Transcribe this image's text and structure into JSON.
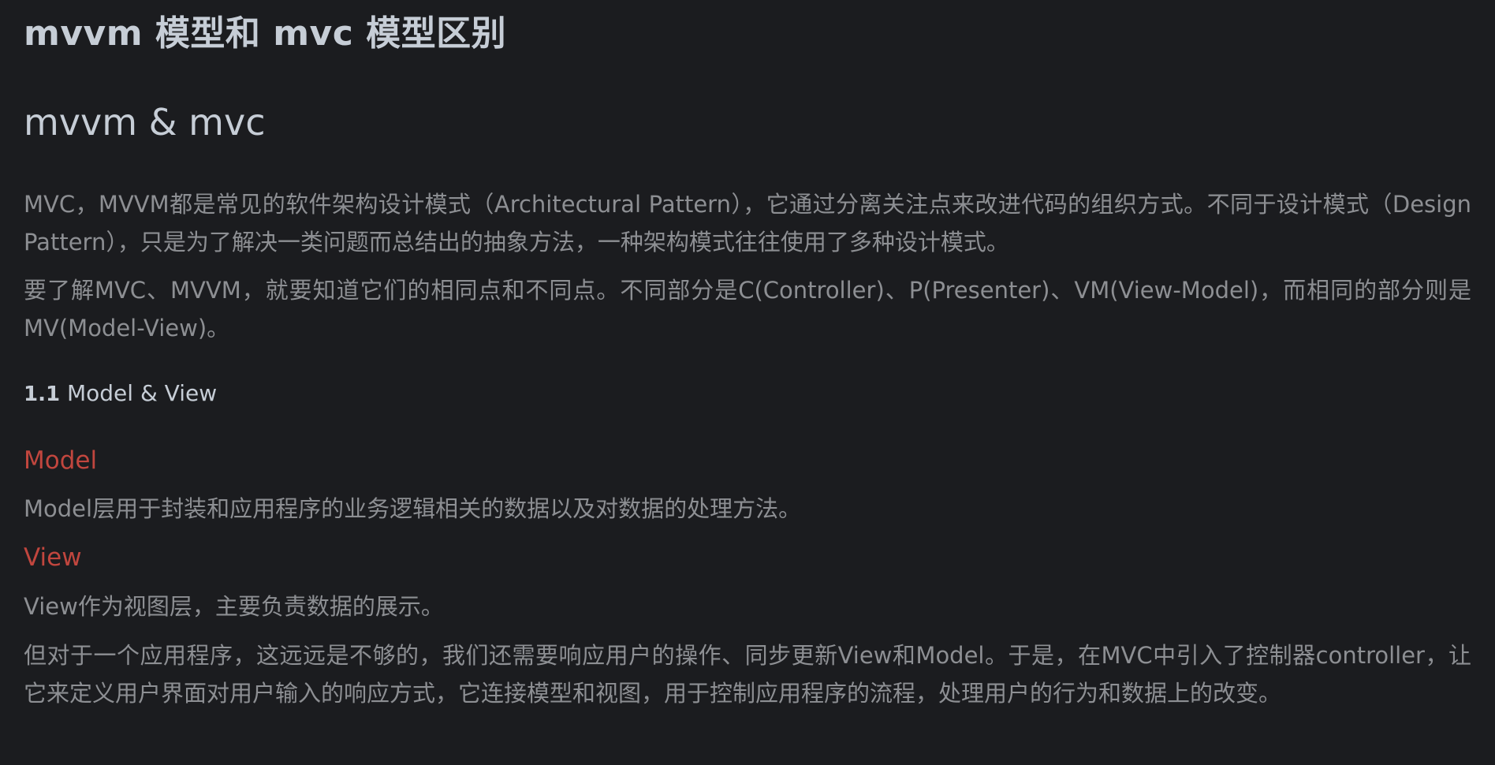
{
  "doc": {
    "title": "mvvm 模型和 mvc 模型区别",
    "subtitle": "mvvm & mvc",
    "intro_paragraph": "MVC，MVVM都是常见的软件架构设计模式（Architectural Pattern），它通过分离关注点来改进代码的组织方式。不同于设计模式（Design Pattern），只是为了解决一类问题而总结出的抽象方法，一种架构模式往往使用了多种设计模式。",
    "diff_paragraph": "要了解MVC、MVVM，就要知道它们的相同点和不同点。不同部分是C(Controller)、P(Presenter)、VM(View-Model)，而相同的部分则是MV(Model-View)。",
    "section": {
      "number": "1.1",
      "heading": "Model & View"
    },
    "model": {
      "term": "Model",
      "description": "Model层用于封装和应用程序的业务逻辑相关的数据以及对数据的处理方法。"
    },
    "view": {
      "term": "View",
      "description": "View作为视图层，主要负责数据的展示。"
    },
    "controller_paragraph": "但对于一个应用程序，这远远是不够的，我们还需要响应用户的操作、同步更新View和Model。于是，在MVC中引入了控制器controller，让它来定义用户界面对用户输入的响应方式，它连接模型和视图，用于控制应用程序的流程，处理用户的行为和数据上的改变。"
  },
  "colors": {
    "background": "#1b1c1f",
    "heading": "#c6cdd6",
    "body_text": "#8d8f93",
    "term_accent": "#c1463e"
  }
}
